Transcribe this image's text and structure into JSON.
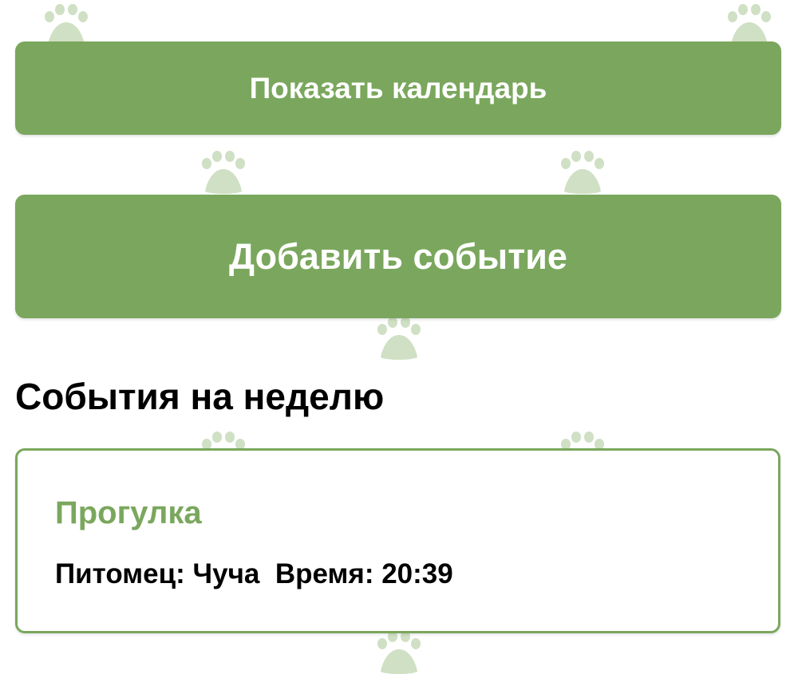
{
  "colors": {
    "accent": "#7aa75d",
    "paw": "#cfe0c4",
    "background": "#ffffff",
    "text": "#000000"
  },
  "buttons": {
    "show_calendar_label": "Показать календарь",
    "add_event_label": "Добавить событие"
  },
  "section": {
    "title": "События на неделю"
  },
  "events": [
    {
      "title": "Прогулка",
      "pet_label": "Питомец:",
      "pet_name": "Чуча",
      "time_label": "Время:",
      "time": "20:39"
    }
  ],
  "background_icon": "paw-print-icon"
}
